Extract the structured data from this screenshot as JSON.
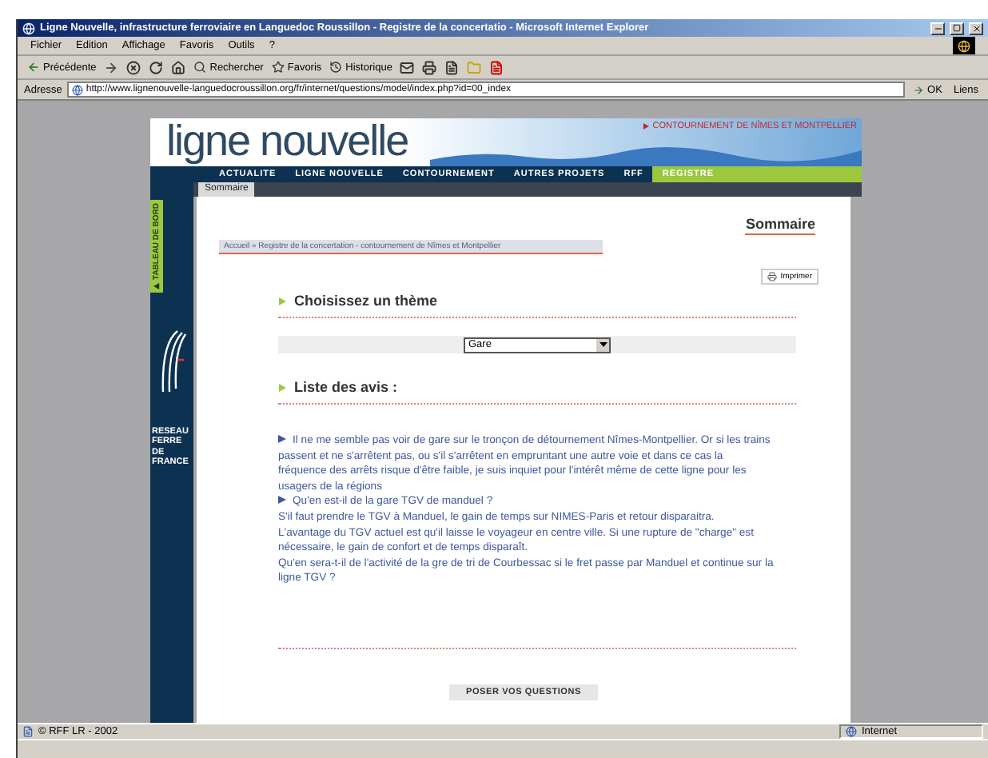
{
  "window": {
    "title": "Ligne Nouvelle, infrastructure ferroviaire en Languedoc Roussillon - Registre de la concertatio - Microsoft Internet Explorer"
  },
  "menu": [
    "Fichier",
    "Edition",
    "Affichage",
    "Favoris",
    "Outils",
    "?"
  ],
  "toolbar": {
    "back": "Précédente",
    "search": "Rechercher",
    "favorites": "Favoris",
    "history": "Historique"
  },
  "address_bar": {
    "label": "Adresse",
    "url": "http://www.lignenouvelle-languedocroussillon.org/fr/internet/questions/model/index.php?id=00_index",
    "go": "OK",
    "links": "Liens"
  },
  "site": {
    "top_link": "CONTOURNEMENT DE NÎMES ET MONTPELLIER",
    "logo": "ligne nouvelle",
    "nav": [
      {
        "label": "ACTUALITE",
        "selected": false
      },
      {
        "label": "LIGNE NOUVELLE",
        "selected": false
      },
      {
        "label": "CONTOURNEMENT",
        "selected": false
      },
      {
        "label": "AUTRES PROJETS",
        "selected": false
      },
      {
        "label": "RFF",
        "selected": false
      },
      {
        "label": "REGISTRE",
        "selected": true
      }
    ],
    "subnav": "Sommaire",
    "side_tab": "TABLEAU DE BORD",
    "network_logo": [
      "RESEAU",
      "FERRE DE",
      "FRANCE"
    ]
  },
  "page": {
    "heading": "Sommaire",
    "breadcrumb": "Accueil » Registre de la concertation - contournement de Nîmes et Montpellier",
    "print": "Imprimer",
    "theme_heading": "Choisissez un thème",
    "theme_select": "Gare",
    "list_heading": "Liste des avis :",
    "avis": [
      {
        "question": "Il ne me semble pas voir de gare sur le tronçon de détournement Nîmes-Montpellier. Or si les trains passent et ne s'arrêtent pas, ou s'il s'arrêtent en empruntant une autre voie et dans ce cas la fréquence des arrêts risque d'être faible, je suis inquiet pour l'intérêt même de cette ligne pour les usagers de la régions"
      },
      {
        "question": "Qu'en est-il de la gare TGV de manduel ?",
        "body": [
          "S'il faut prendre le TGV à Manduel, le gain de temps sur NIMES-Paris et retour disparaitra.",
          "L'avantage du TGV actuel est qu'il laisse le voyageur en centre ville. Si une rupture de \"charge\" est nécessaire, le gain de confort et de temps disparaît.",
          "Qu'en sera-t-il de l'activité de la gre de tri de Courbessac si le fret passe par Manduel et continue sur la ligne TGV ?"
        ]
      }
    ],
    "ask_button": "POSER VOS QUESTIONS"
  },
  "status_bar": {
    "text": "© RFF LR - 2002",
    "zone": "Internet"
  }
}
